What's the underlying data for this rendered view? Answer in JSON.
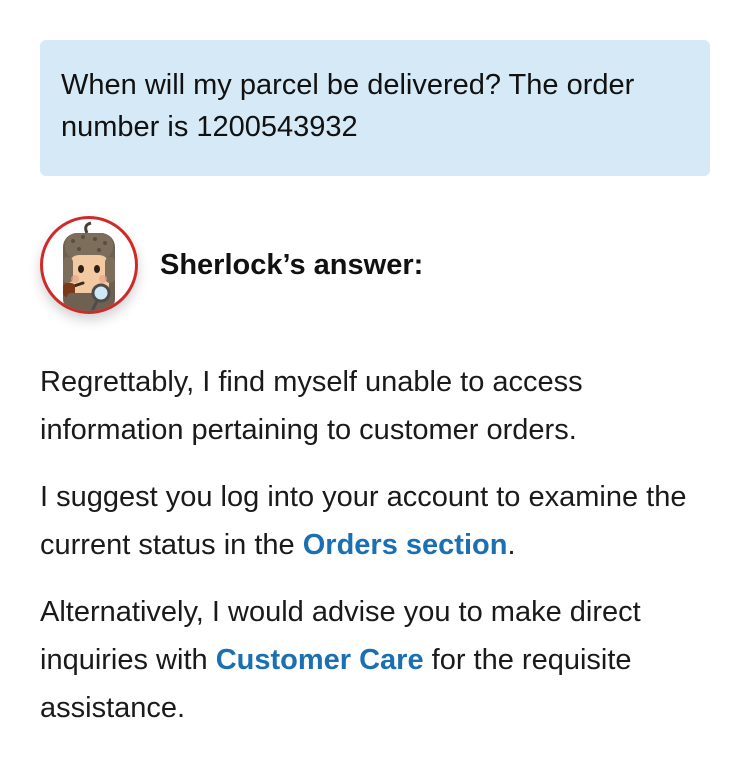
{
  "question": {
    "text": "When will my parcel be delivered? The order number is 1200543932"
  },
  "answer": {
    "avatar_icon": "sherlock-detective-icon",
    "title": "Sherlock’s answer:",
    "paragraph1": "Regrettably, I find myself unable to access information pertaining to customer orders.",
    "paragraph2_before": "I suggest you log into your account to examine the current status in the ",
    "paragraph2_link": "Orders section",
    "paragraph2_after": ".",
    "paragraph3_before": "Alternatively, I would advise you to make direct inquiries with ",
    "paragraph3_link": "Customer Care",
    "paragraph3_after": " for the requisite assistance."
  },
  "colors": {
    "question_bg": "#d6e9f6",
    "link": "#1b6fb3",
    "avatar_border": "#cf2a2a"
  }
}
